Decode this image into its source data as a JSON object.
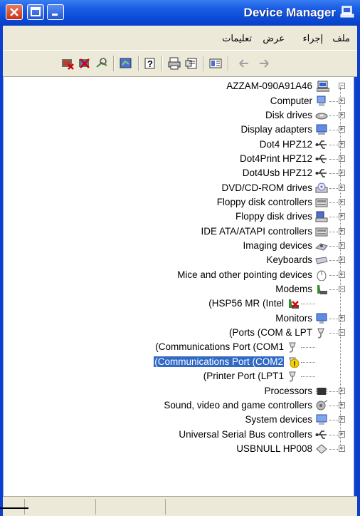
{
  "window": {
    "title": "Device Manager"
  },
  "menu": {
    "file": "ملف",
    "action": "إجراء",
    "view": "عرض",
    "help": "تعليمات"
  },
  "toolbar": {
    "buttons": [
      "uninstall-icon",
      "disable-icon",
      "scan-icon",
      "update-driver-icon",
      "help-icon",
      "print-icon",
      "properties-icon",
      "tree-toggle-icon",
      "back-icon",
      "forward-icon"
    ]
  },
  "tree": {
    "root": "AZZAM-090A91A46",
    "items": [
      {
        "label": "Computer",
        "icon": "computer-icon",
        "expander": "+"
      },
      {
        "label": "Disk drives",
        "icon": "disk-drive-icon",
        "expander": "+"
      },
      {
        "label": "Display adapters",
        "icon": "display-adapter-icon",
        "expander": "+"
      },
      {
        "label": "Dot4 HPZ12",
        "icon": "usb-icon",
        "expander": "+"
      },
      {
        "label": "Dot4Print HPZ12",
        "icon": "usb-icon",
        "expander": "+"
      },
      {
        "label": "Dot4Usb HPZ12",
        "icon": "usb-icon",
        "expander": "+"
      },
      {
        "label": "DVD/CD-ROM drives",
        "icon": "cdrom-icon",
        "expander": "+"
      },
      {
        "label": "Floppy disk controllers",
        "icon": "controller-icon",
        "expander": "+"
      },
      {
        "label": "Floppy disk drives",
        "icon": "floppy-drive-icon",
        "expander": "+"
      },
      {
        "label": "IDE ATA/ATAPI controllers",
        "icon": "controller-icon",
        "expander": "+"
      },
      {
        "label": "Imaging devices",
        "icon": "imaging-icon",
        "expander": "+"
      },
      {
        "label": "Keyboards",
        "icon": "keyboard-icon",
        "expander": "+"
      },
      {
        "label": "Mice and other pointing devices",
        "icon": "mouse-icon",
        "expander": "+"
      },
      {
        "label": "Modems",
        "icon": "modem-icon",
        "expander": "−"
      },
      {
        "label": "(HSP56 MR (Intel",
        "icon": "modem-disabled-icon",
        "child": true
      },
      {
        "label": "Monitors",
        "icon": "monitor-icon",
        "expander": "+"
      },
      {
        "label": "(Ports (COM & LPT",
        "icon": "port-icon",
        "expander": "−"
      },
      {
        "label": "(Communications Port (COM1",
        "icon": "port-icon",
        "child": true
      },
      {
        "label": "(Communications Port (COM2",
        "icon": "port-warning-icon",
        "child": true,
        "selected": true
      },
      {
        "label": "(Printer Port (LPT1",
        "icon": "port-icon",
        "child": true
      },
      {
        "label": "Processors",
        "icon": "processor-icon",
        "expander": "+"
      },
      {
        "label": "Sound, video and game controllers",
        "icon": "sound-icon",
        "expander": "+"
      },
      {
        "label": "System devices",
        "icon": "system-device-icon",
        "expander": "+"
      },
      {
        "label": "Universal Serial Bus controllers",
        "icon": "usb-icon",
        "expander": "+"
      },
      {
        "label": "USBNULL HP008",
        "icon": "unknown-device-icon",
        "expander": "+"
      }
    ]
  },
  "colors": {
    "titlebar": "#0b4bd8",
    "selection": "#316ac5",
    "chrome": "#ece9d8"
  }
}
